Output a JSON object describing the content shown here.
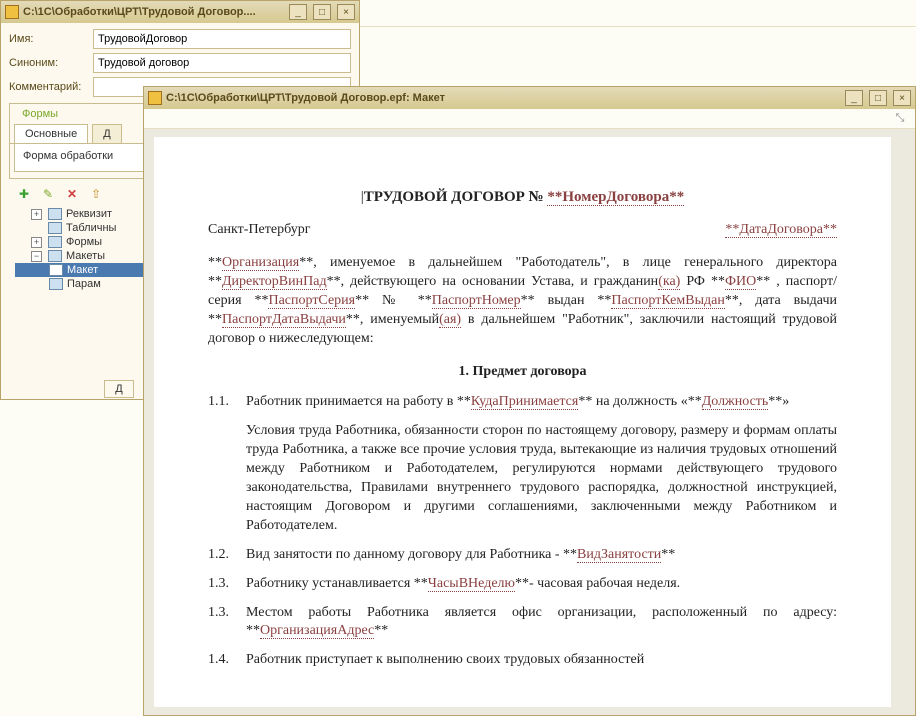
{
  "bgWindow": {
    "title": "C:\\1С\\Обработки\\ЦРТ\\Трудовой Договор....",
    "fields": {
      "nameLabel": "Имя:",
      "nameValue": "ТрудовойДоговор",
      "synLabel": "Синоним:",
      "synValue": "Трудовой договор",
      "commLabel": "Комментарий:",
      "commValue": ""
    },
    "formsGroupTitle": "Формы",
    "tabs": {
      "main": "Основные",
      "other": "Д"
    },
    "tabBodyText": "Форма обработки",
    "tree": {
      "rekv": "Реквизит",
      "tabl": "Табличны",
      "formy": "Формы",
      "makety": "Макеты",
      "maket": "Макет",
      "param": "Парам"
    },
    "bottomBtn": "Д"
  },
  "docWindow": {
    "title": "C:\\1С\\Обработки\\ЦРТ\\Трудовой Договор.epf: Макет"
  },
  "doc": {
    "h1_pre": "ТРУДОВОЙ ДОГОВОР   № ",
    "h1_field": "**НомерДоговора**",
    "city": "Санкт-Петербург",
    "dateField": "**ДатаДоговора**",
    "p1": {
      "a": "**",
      "org": "Организация",
      "b": "**, именуемое в дальнейшем \"Работодатель\",  в лице  генерального директора **",
      "dir": "ДиректорВинПад",
      "c": "**, действующего  на основании Устава, и гражданин",
      "ka": "(ка)",
      "d": " РФ **",
      "fio": "ФИО",
      "e": "** , паспорт/серия **",
      "ps": "ПаспортСерия",
      "f": "** № **",
      "pn": "ПаспортНомер",
      "g": "** выдан **",
      "pkv": "ПаспортКемВыдан",
      "h": "**, дата выдачи **",
      "pdv": "ПаспортДатаВыдачи",
      "i": "**, именуемый",
      "aya": "(ая)",
      "j": " в дальнейшем \"Работник\", заключили настоящий трудовой договор о нижеследующем:"
    },
    "section1": "1.  Предмет договора",
    "c11": {
      "num": "1.1.",
      "a": "Работник принимается на работу в **",
      "kp": "КудаПринимается",
      "b": "** на должность «**",
      "dol": "Должность",
      "c": "**»",
      "sub": "Условия труда Работника, обязанности сторон по настоящему договору, размеру и формам оплаты труда Работника, а также все прочие условия труда, вытекающие из наличия трудовых отношений между Работником и Работодателем, регулируются нормами действующего трудового законодательства, Правилами внутреннего трудового распорядка, должностной инструкцией, настоящим Договором и другими соглашениями, заключенными между  Работником и Работодателем."
    },
    "c12": {
      "num": "1.2.",
      "a": "Вид занятости по данному договору для Работника - **",
      "vz": "ВидЗанятости",
      "b": "**"
    },
    "c13a": {
      "num": "1.3.",
      "a": "Работнику устанавливается  **",
      "ch": "ЧасыВНеделю",
      "b": "**- часовая рабочая неделя."
    },
    "c13b": {
      "num": "1.3.",
      "a": "Местом работы Работника является офис организации, расположенный по адресу: **",
      "oa": "ОрганизацияАдрес",
      "b": "**"
    },
    "c14": {
      "num": "1.4.",
      "a": "Работник приступает  к выполнению своих трудовых обязанностей"
    }
  }
}
